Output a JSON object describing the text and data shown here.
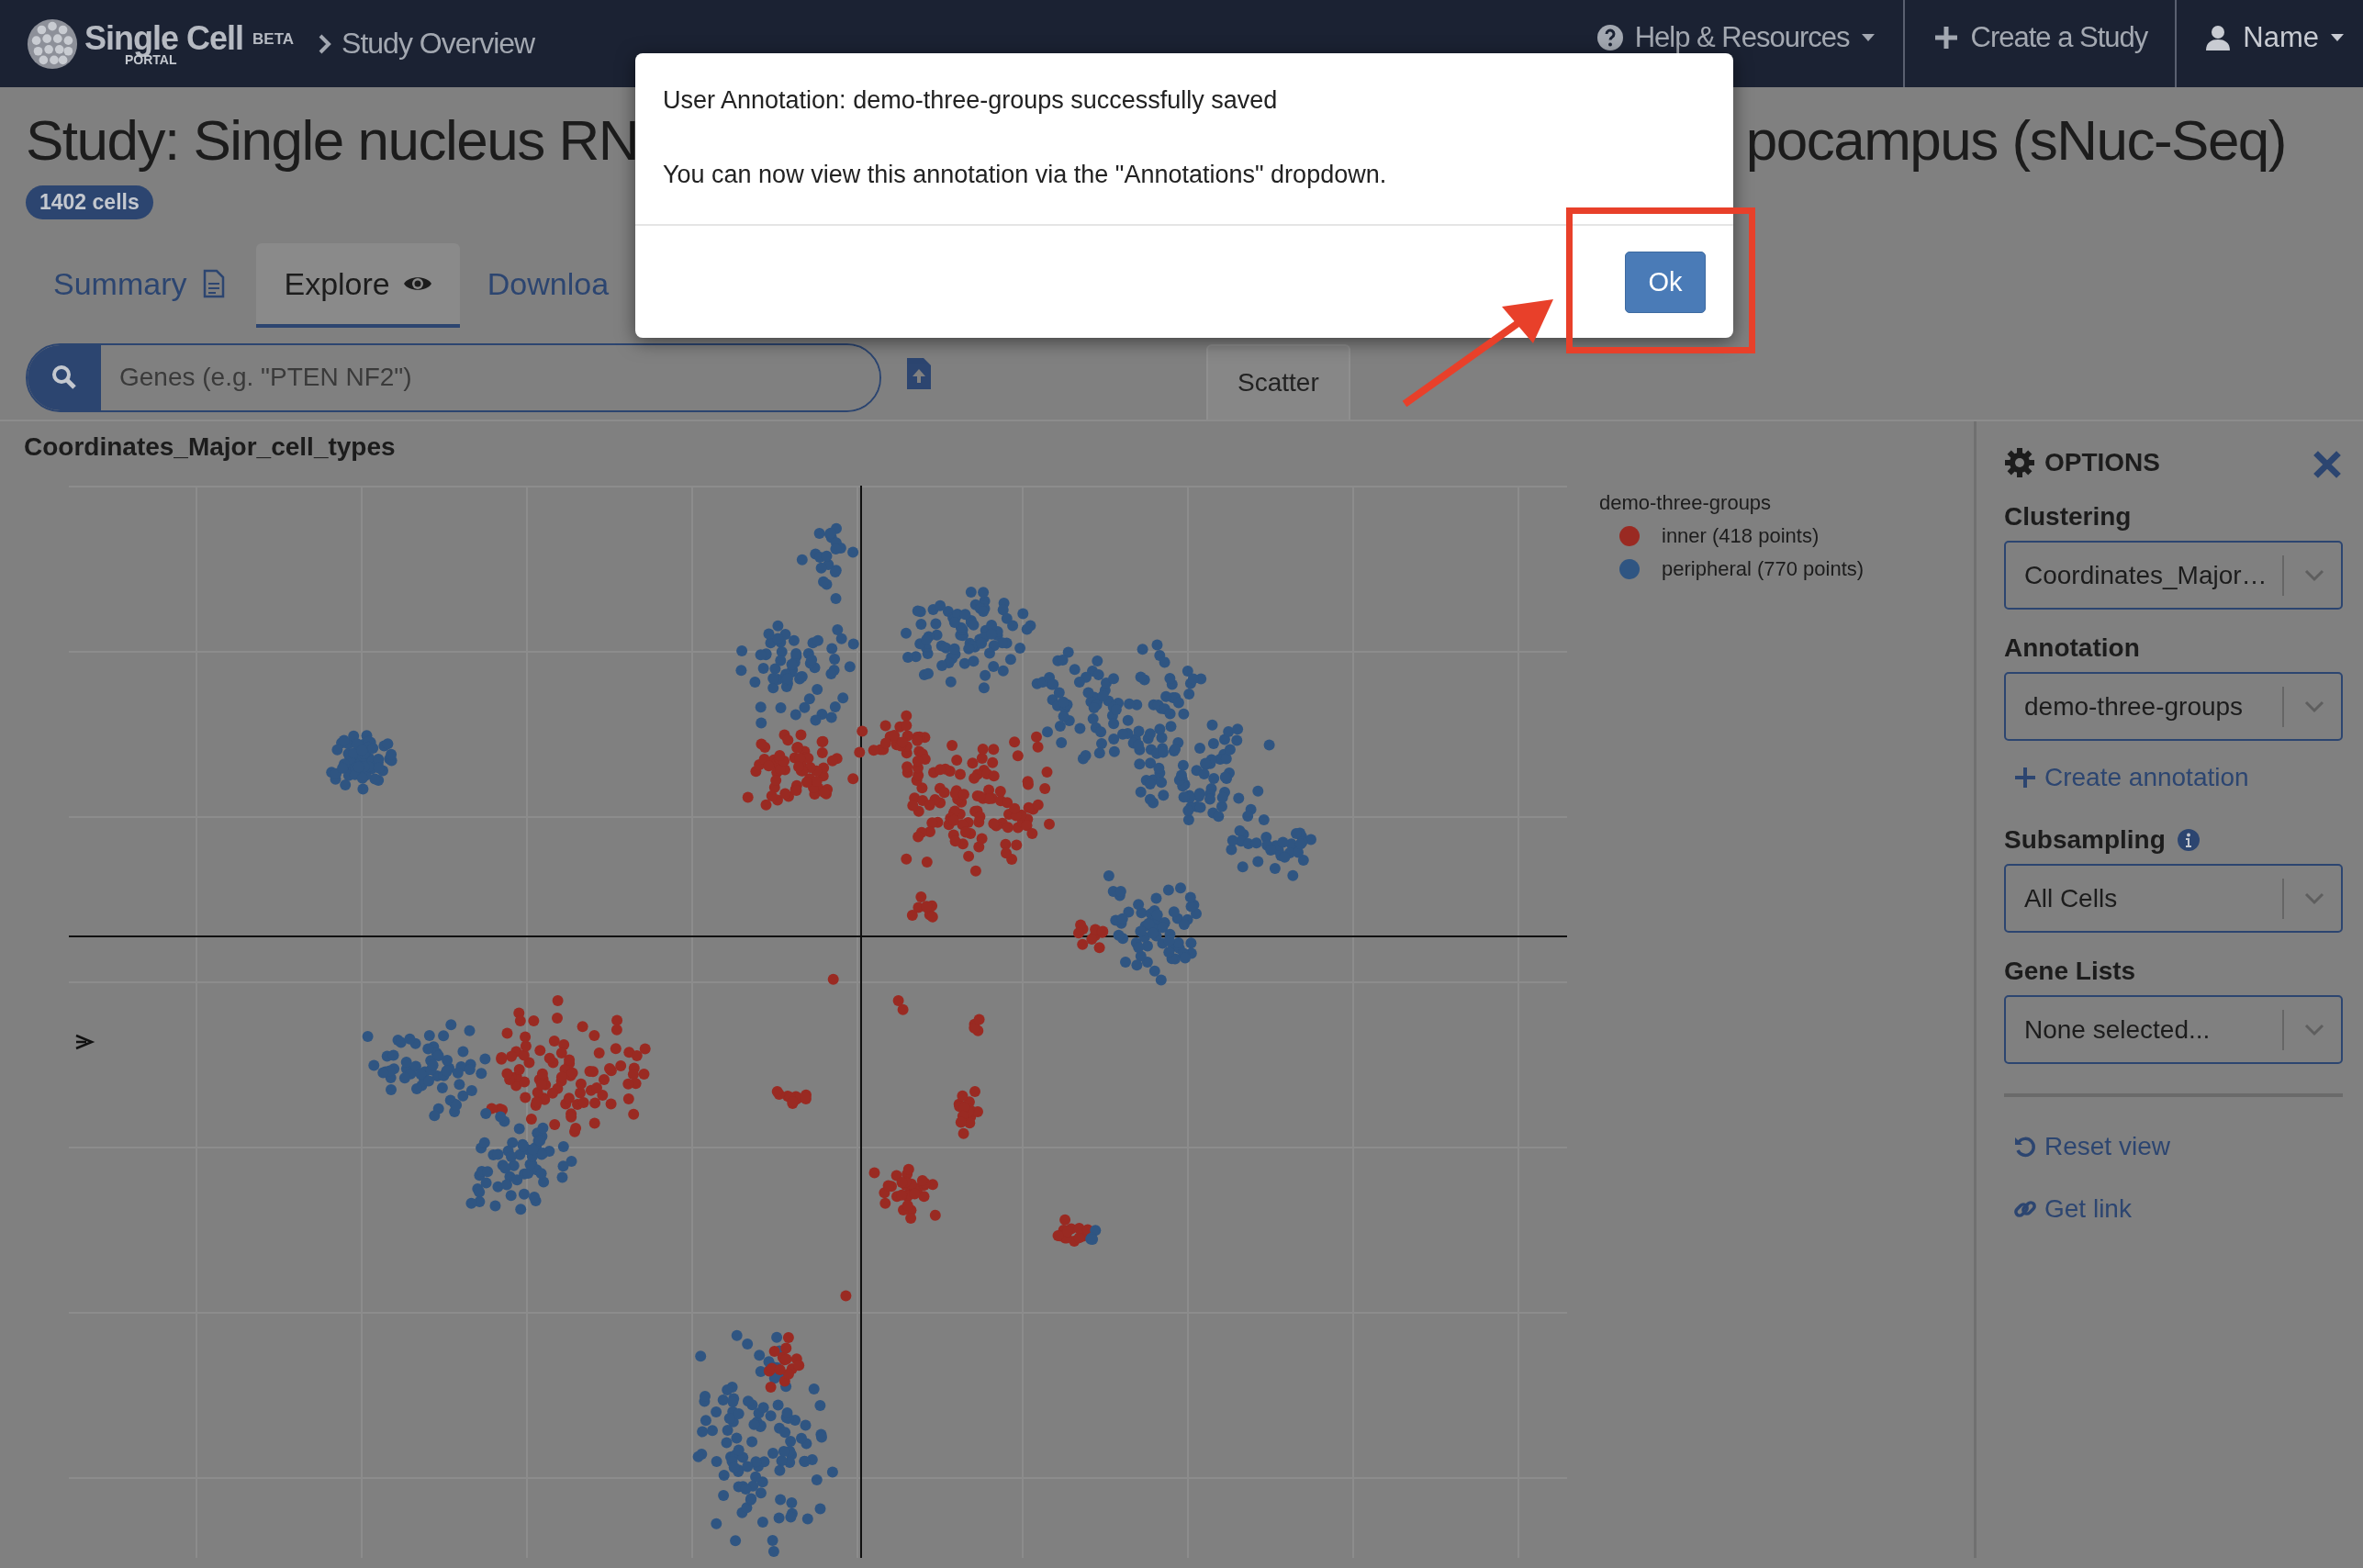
{
  "navbar": {
    "logo": {
      "name": "Single Cell",
      "sub": "PORTAL",
      "badge": "BETA"
    },
    "breadcrumb": "Study Overview",
    "menu": [
      {
        "label": "Help & Resources",
        "kind": "help"
      },
      {
        "label": "Create a Study",
        "kind": "create"
      },
      {
        "label": "Name",
        "kind": "user"
      }
    ]
  },
  "study": {
    "title_start": "Study: Single nucleus RN",
    "title_end": "pocampus (sNuc-Seq)",
    "cell_count": "1402 cells"
  },
  "tabs": [
    {
      "label": "Summary",
      "selected": false
    },
    {
      "label": "Explore",
      "selected": true
    },
    {
      "label": "Downloa",
      "selected": false
    }
  ],
  "search": {
    "placeholder": "Genes (e.g. \"PTEN NF2\")"
  },
  "plot_tabs": [
    {
      "label": "Scatter",
      "selected": true
    }
  ],
  "plot": {
    "title": "Coordinates_Major_cell_types",
    "legend": {
      "title": "demo-three-groups",
      "items": [
        {
          "label": "inner (418 points)",
          "color": "#9a2a22"
        },
        {
          "label": "peripheral (770 points)",
          "color": "#2f5582"
        }
      ]
    }
  },
  "options": {
    "title": "OPTIONS",
    "items": [
      {
        "kind": "select",
        "label": "Clustering",
        "value": "Coordinates_Major…",
        "info": false
      },
      {
        "kind": "select",
        "label": "Annotation",
        "value": "demo-three-groups",
        "info": false
      },
      {
        "kind": "link",
        "label": "Create annotation"
      },
      {
        "kind": "select",
        "label": "Subsampling",
        "value": "All Cells",
        "info": true
      },
      {
        "kind": "select",
        "label": "Gene Lists",
        "value": "None selected...",
        "info": false
      }
    ],
    "actions": [
      {
        "kind": "reset",
        "label": "Reset view"
      },
      {
        "kind": "link",
        "label": "Get link"
      }
    ]
  },
  "modal": {
    "message": "User Annotation: demo-three-groups successfully saved",
    "note": "You can now view this annotation via the \"Annotations\" dropdown.",
    "button": "Ok"
  }
}
